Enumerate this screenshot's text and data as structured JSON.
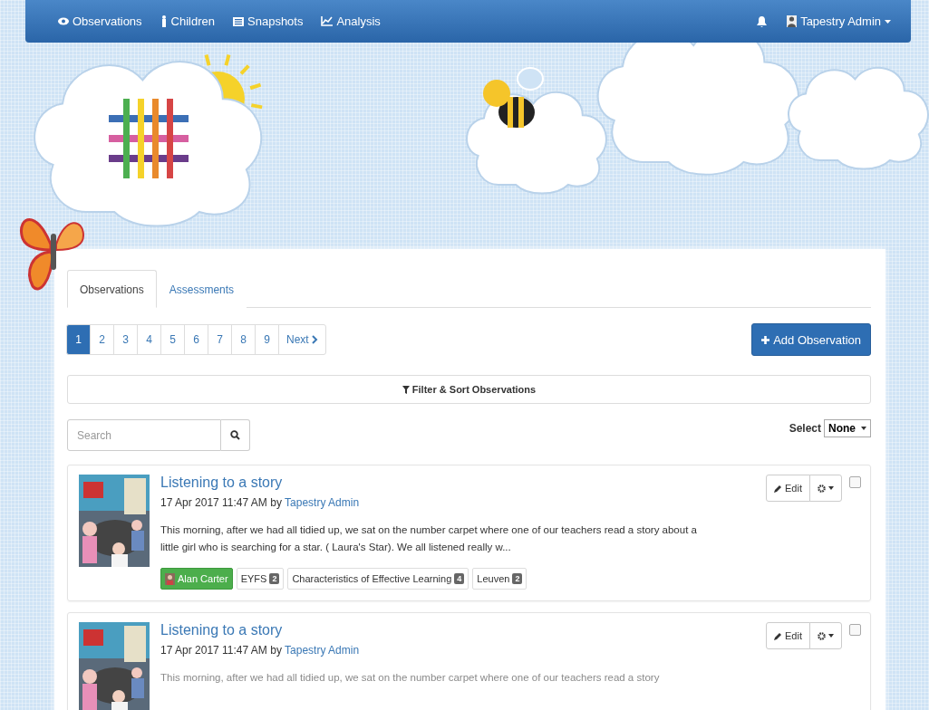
{
  "navbar": {
    "items": [
      {
        "label": "Observations"
      },
      {
        "label": "Children"
      },
      {
        "label": "Snapshots"
      },
      {
        "label": "Analysis"
      }
    ],
    "user": "Tapestry Admin"
  },
  "tabs": [
    {
      "label": "Observations",
      "selected": true
    },
    {
      "label": "Assessments",
      "selected": false
    }
  ],
  "pagination": {
    "pages": [
      {
        "label": "1",
        "selected": true
      },
      {
        "label": "2",
        "selected": false
      },
      {
        "label": "3",
        "selected": false
      },
      {
        "label": "4",
        "selected": false
      },
      {
        "label": "5",
        "selected": false
      },
      {
        "label": "6",
        "selected": false
      },
      {
        "label": "7",
        "selected": false
      },
      {
        "label": "8",
        "selected": false
      },
      {
        "label": "9",
        "selected": false
      }
    ],
    "next": "Next"
  },
  "add_button": "Add Observation",
  "filter_button": "Filter & Sort Observations",
  "search": {
    "placeholder": "Search"
  },
  "select": {
    "label": "Select",
    "value": "None"
  },
  "observations": [
    {
      "title": "Listening to a story",
      "date": "17 Apr 2017 11:47 AM",
      "by": "by",
      "author": "Tapestry Admin",
      "description": "This morning, after we had all tidied up, we sat on the number carpet where one of our teachers read a story about a little girl who is searching for a star. ( Laura's Star). We all listened really w...",
      "tags": [
        {
          "kind": "person",
          "label": "Alan Carter"
        },
        {
          "kind": "framework",
          "label": "EYFS",
          "count": "2"
        },
        {
          "kind": "framework",
          "label": "Characteristics of Effective Learning",
          "count": "4"
        },
        {
          "kind": "framework",
          "label": "Leuven",
          "count": "2"
        }
      ],
      "edit": "Edit",
      "checked": false,
      "faded": false
    },
    {
      "title": "Listening to a story",
      "date": "17 Apr 2017 11:47 AM",
      "by": "by",
      "author": "Tapestry Admin",
      "description": "This morning, after we had all tidied up, we sat on the number carpet where one of our teachers read a story",
      "edit": "Edit",
      "checked": false,
      "faded": true
    }
  ]
}
